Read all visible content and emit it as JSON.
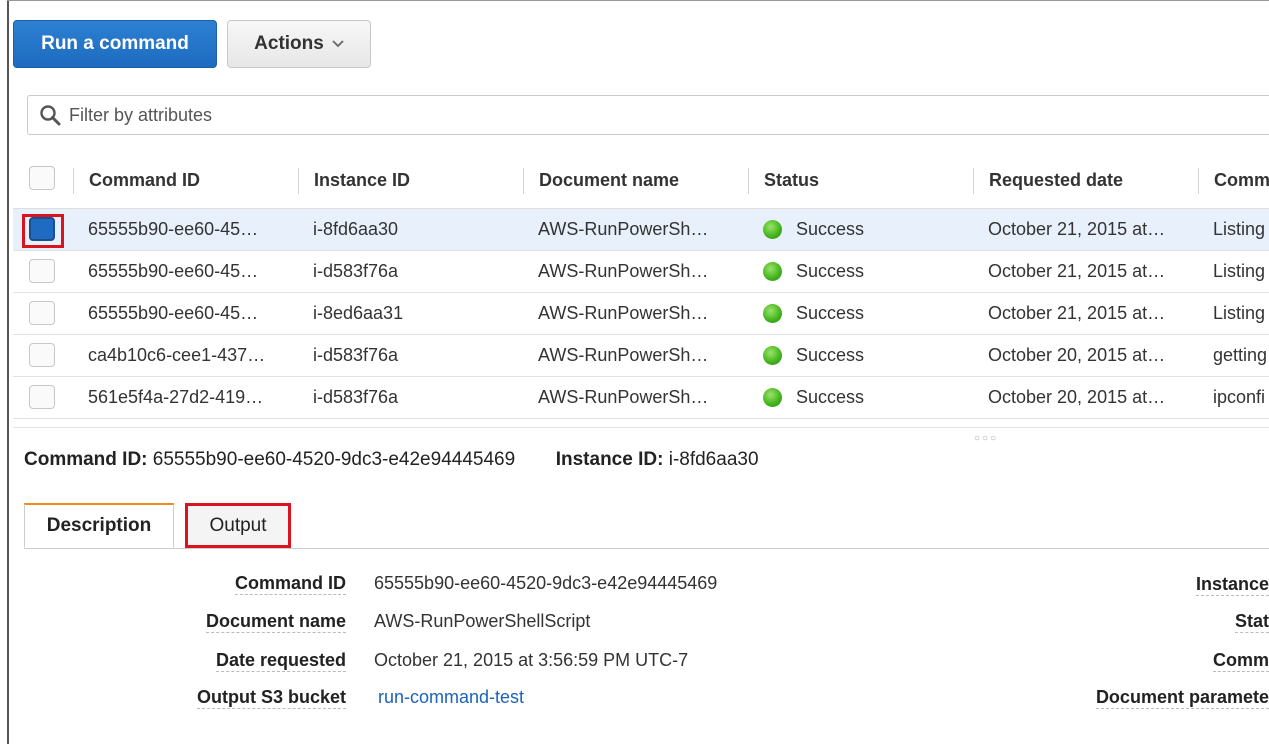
{
  "toolbar": {
    "run_label": "Run a command",
    "actions_label": "Actions"
  },
  "filter": {
    "placeholder": "Filter by attributes"
  },
  "table": {
    "columns": [
      "Command ID",
      "Instance ID",
      "Document name",
      "Status",
      "Requested date",
      "Comm"
    ],
    "rows": [
      {
        "command_id": "65555b90-ee60-45…",
        "instance_id": "i-8fd6aa30",
        "document": "AWS-RunPowerSh…",
        "status": "Success",
        "requested": "October 21, 2015 at…",
        "comment": "Listing",
        "selected": true
      },
      {
        "command_id": "65555b90-ee60-45…",
        "instance_id": "i-d583f76a",
        "document": "AWS-RunPowerSh…",
        "status": "Success",
        "requested": "October 21, 2015 at…",
        "comment": "Listing",
        "selected": false
      },
      {
        "command_id": "65555b90-ee60-45…",
        "instance_id": "i-8ed6aa31",
        "document": "AWS-RunPowerSh…",
        "status": "Success",
        "requested": "October 21, 2015 at…",
        "comment": "Listing",
        "selected": false
      },
      {
        "command_id": "ca4b10c6-cee1-437…",
        "instance_id": "i-d583f76a",
        "document": "AWS-RunPowerSh…",
        "status": "Success",
        "requested": "October 20, 2015 at…",
        "comment": "getting",
        "selected": false
      },
      {
        "command_id": "561e5f4a-27d2-419…",
        "instance_id": "i-d583f76a",
        "document": "AWS-RunPowerSh…",
        "status": "Success",
        "requested": "October 20, 2015 at…",
        "comment": "ipconfi",
        "selected": false
      }
    ]
  },
  "detail": {
    "command_id_label": "Command ID:",
    "command_id_value": "65555b90-ee60-4520-9dc3-e42e94445469",
    "instance_id_label": "Instance ID:",
    "instance_id_value": "i-8fd6aa30",
    "tabs": {
      "description": "Description",
      "output": "Output"
    },
    "fields": {
      "command_id_k": "Command ID",
      "command_id_v": "65555b90-ee60-4520-9dc3-e42e94445469",
      "document_k": "Document name",
      "document_v": "AWS-RunPowerShellScript",
      "date_k": "Date requested",
      "date_v": "October 21, 2015 at 3:56:59 PM UTC-7",
      "bucket_k": "Output S3 bucket",
      "bucket_v": "run-command-test"
    },
    "right_labels": [
      "Instance",
      "Stat",
      "Comm",
      "Document paramete"
    ]
  },
  "colors": {
    "primary": "#1d6bc0",
    "success": "#3fb21a",
    "highlight": "#d9141e",
    "tab_accent": "#f08a1c",
    "link": "#1a63b8"
  },
  "icons": {
    "filter": "search-icon",
    "actions": "chevron-down-icon",
    "status": "success-dot-icon"
  }
}
